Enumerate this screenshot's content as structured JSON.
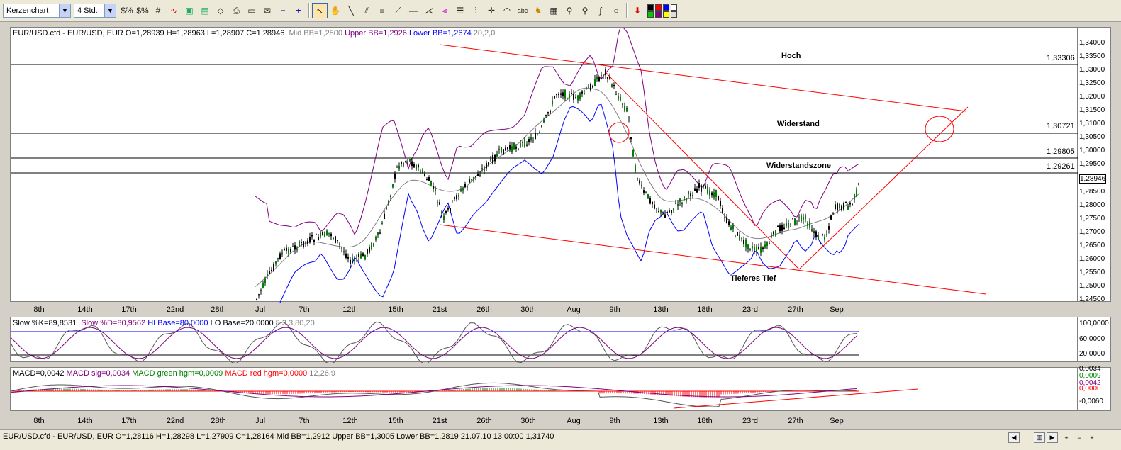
{
  "toolbar": {
    "chart_type": "Kerzenchart",
    "interval": "4 Std."
  },
  "main": {
    "header": {
      "instrument": "EUR/USD.cfd - EUR/USD, EUR O=1,28939 H=1,28963 L=1,28907 C=1,28946",
      "mid": "Mid BB=1,2800",
      "upper": "Upper BB=1,2926",
      "lower": "Lower BB=1,2674",
      "params": "20,2,0"
    },
    "annotations": {
      "hoch": "Hoch",
      "widerstand": "Widerstand",
      "zone": "Widerstandszone",
      "tief": "Tieferes Tief"
    },
    "level_labels": [
      "1,33306",
      "1,30721",
      "1,29805",
      "1,29261"
    ],
    "last_price": "1,28946",
    "price_ticks": [
      "1,34000",
      "1,33500",
      "1,33000",
      "1,32500",
      "1,32000",
      "1,31500",
      "1,31000",
      "1,30500",
      "1,30000",
      "1,29500",
      "1,28500",
      "1,28000",
      "1,27500",
      "1,27000",
      "1,26500",
      "1,26000",
      "1,25500",
      "1,25000",
      "1,24500"
    ]
  },
  "stoch": {
    "k": "Slow %K=89,8531",
    "d": "Slow %D=80,9562",
    "hi": "HI Base=80,0000",
    "lo": "LO Base=20,0000",
    "params": "8,3,3,80,20",
    "ticks": [
      "100,0000",
      "60,0000",
      "20,0000"
    ]
  },
  "macd": {
    "macd": "MACD=0,0042",
    "sig": "MACD sig=0,0034",
    "green": "MACD green hgm=0,0009",
    "red": "MACD red hgm=0,0000",
    "params": "12,26,9",
    "ticks": [
      "0,0034",
      "0,0009",
      "0,0042",
      "0,0000",
      "-0,0060"
    ]
  },
  "dates": [
    "8th",
    "14th",
    "17th",
    "22nd",
    "28th",
    "Jul",
    "7th",
    "12th",
    "15th",
    "21st",
    "26th",
    "30th",
    "Aug",
    "9th",
    "13th",
    "18th",
    "23rd",
    "27th",
    "Sep"
  ],
  "status": {
    "text": "EUR/USD.cfd - EUR/USD, EUR O=1,28116 H=1,28298 L=1,27909 C=1,28164  Mid BB=1,2912 Upper BB=1,3005 Lower BB=1,2819  21.07.10 13:00:00 1,31740"
  },
  "colors": {
    "upper_bb": "#800080",
    "lower_bb": "#0000ff",
    "mid_bb": "#808080",
    "trend": "#ff0000",
    "bull": "#008000",
    "bear": "#000000"
  }
}
